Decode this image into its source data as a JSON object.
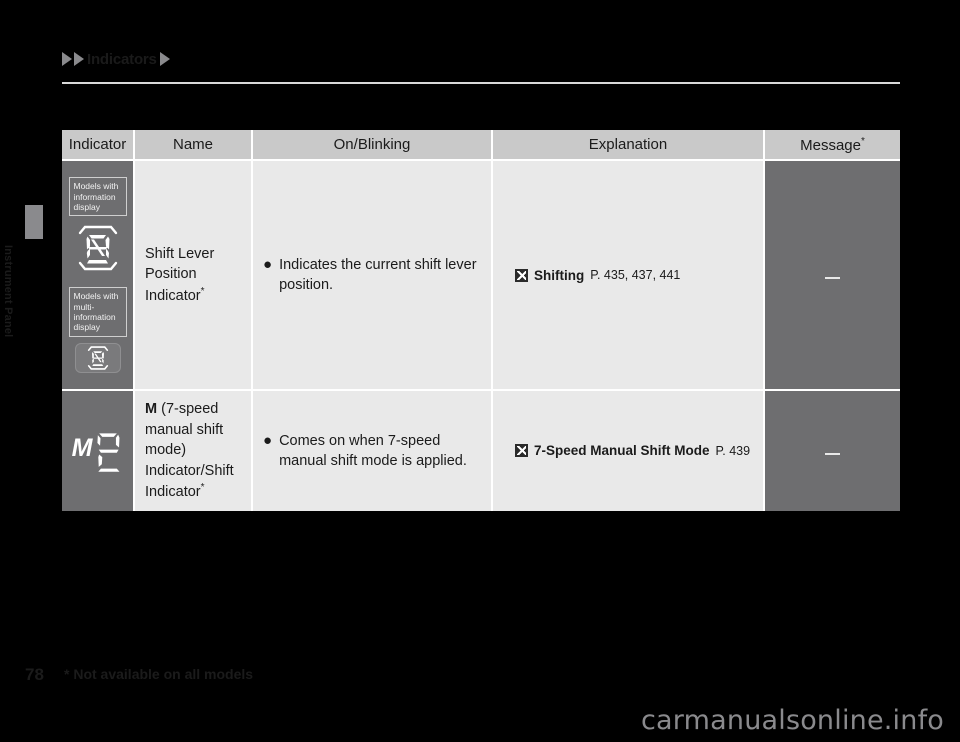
{
  "breadcrumb": {
    "label": "Indicators"
  },
  "side_tab": {
    "label": "Instrument Panel"
  },
  "table": {
    "headers": {
      "indicator": "Indicator",
      "name": "Name",
      "on_blinking": "On/Blinking",
      "explanation": "Explanation",
      "message": "Message",
      "message_sup": "*"
    },
    "rows": [
      {
        "indicator": {
          "label_1": "Models with information display",
          "icon_1": "shift-position-segment-icon",
          "label_2": "Models with multi-information display",
          "icon_2": "shift-position-segment-icon-small"
        },
        "name": "Shift Lever Position Indicator",
        "name_sup": "*",
        "on_blinking": "Indicates the current shift lever position.",
        "explanation": {
          "ref_icon": "jump-to-reference-icon",
          "title": "Shifting",
          "pages": "P. 435, 437, 441"
        },
        "message": "—"
      },
      {
        "indicator": {
          "icon_1": "m2-manual-shift-icon",
          "letter": "M",
          "digit": "2"
        },
        "name_bold": "M",
        "name": " (7-speed manual shift mode) Indicator/Shift Indicator",
        "name_sup": "*",
        "on_blinking": "Comes on when 7-speed manual shift mode is applied.",
        "explanation": {
          "ref_icon": "jump-to-reference-icon",
          "title": "7-Speed Manual Shift Mode",
          "pages": "P. 439"
        },
        "message": "—"
      }
    ]
  },
  "footer": {
    "page_number": "78",
    "footnote": "* Not available on all models"
  },
  "watermark": {
    "text": "carmanualsonline.info"
  },
  "colors": {
    "page_background": "#000000",
    "header_band": "#c9c9c9",
    "cell_light": "#e9e9e9",
    "cell_dark": "#6e6e70",
    "rule": "#d9d9d9",
    "watermark": "#8a8a8d"
  }
}
